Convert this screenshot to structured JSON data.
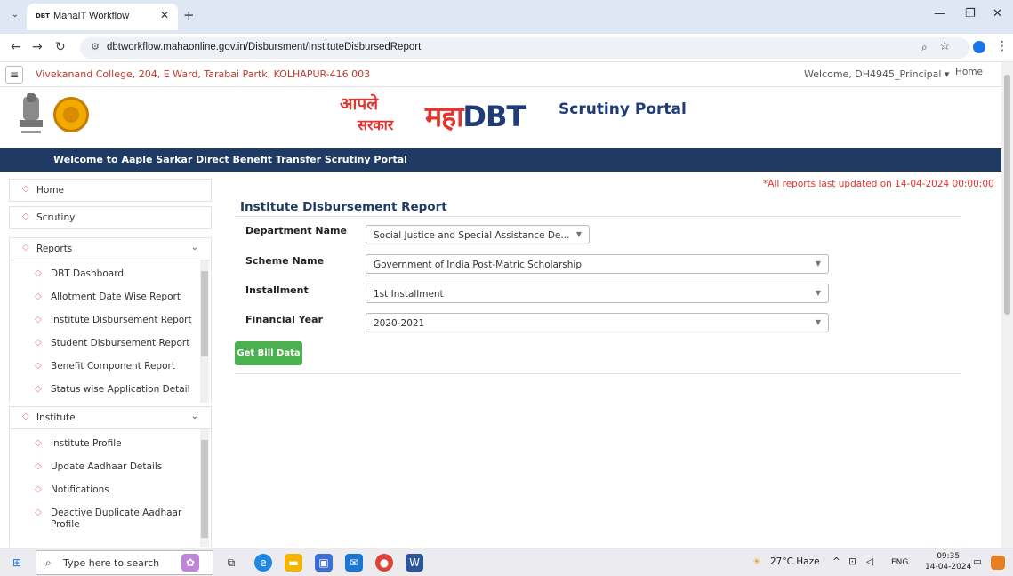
{
  "browser": {
    "tab_favicon": "DBT",
    "tab_title": "MahaIT Workflow",
    "url": "dbtworkflow.mahaonline.gov.in/Disbursment/InstituteDisbursedReport"
  },
  "header": {
    "college": "Vivekanand College, 204, E Ward, Tarabai Partk, KOLHAPUR-416 003",
    "welcome": "Welcome, DH4945_Principal ▾",
    "home": "Home"
  },
  "logo": {
    "aaple": "आपले",
    "sarkar": "सरकार",
    "maha": "महा",
    "dbt": "DBT",
    "portal": "Scrutiny Portal"
  },
  "banner": "Welcome to Aaple Sarkar Direct Benefit Transfer Scrutiny Portal",
  "sidebar": {
    "home": "Home",
    "scrutiny": "Scrutiny",
    "reports": "Reports",
    "report_items": [
      "DBT Dashboard",
      "Allotment Date Wise Report",
      "Institute Disbursement Report",
      "Student Disbursement Report",
      "Benefit Component Report",
      "Status wise Application Detail"
    ],
    "institute": "Institute",
    "institute_items": [
      "Institute Profile",
      "Update Aadhaar Details",
      "Notifications",
      "Deactive Duplicate Aadhaar Profile"
    ]
  },
  "main": {
    "updated_note": "*All reports last updated on 14-04-2024 00:00:00",
    "title": "Institute Disbursement Report",
    "fields": {
      "department_label": "Department Name",
      "department_value": "Social Justice and Special Assistance De...",
      "scheme_label": "Scheme Name",
      "scheme_value": "Government of India Post-Matric Scholarship",
      "installment_label": "Installment",
      "installment_value": "1st Installment",
      "year_label": "Financial Year",
      "year_value": "2020-2021"
    },
    "get_button": "Get Bill Data"
  },
  "taskbar": {
    "search_placeholder": "Type here to search",
    "weather": "27°C  Haze",
    "lang": "ENG",
    "time": "09:35",
    "date": "14-04-2024"
  },
  "colors": {
    "brand_red": "#e3342f",
    "brand_blue": "#1f3b63",
    "button_green": "#4caf50"
  }
}
